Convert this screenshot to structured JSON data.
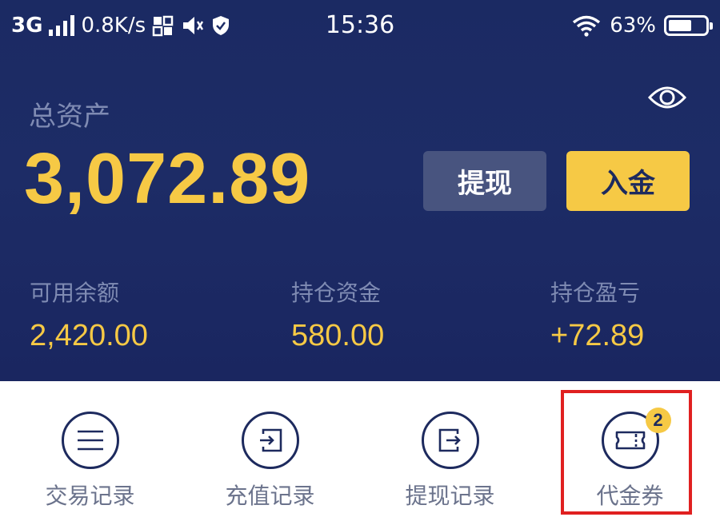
{
  "status_bar": {
    "network": "3G",
    "speed": "0.8K/s",
    "time": "15:36",
    "battery_text": "63%",
    "battery_level": 0.63
  },
  "account": {
    "total_label": "总资产",
    "total_value": "3,072.89",
    "withdraw_label": "提现",
    "deposit_label": "入金",
    "stats": [
      {
        "label": "可用余额",
        "value": "2,420.00"
      },
      {
        "label": "持仓资金",
        "value": "580.00"
      },
      {
        "label": "持仓盈亏",
        "value": "+72.89"
      }
    ]
  },
  "quick_actions": [
    {
      "label": "交易记录",
      "icon": "list-icon"
    },
    {
      "label": "充值记录",
      "icon": "login-icon"
    },
    {
      "label": "提现记录",
      "icon": "exit-icon"
    },
    {
      "label": "代金券",
      "icon": "ticket-icon",
      "badge": "2"
    }
  ],
  "colors": {
    "background": "#1d2c66",
    "accent": "#f6c945",
    "muted_text": "#7f8bb3",
    "highlight_border": "#e02020"
  }
}
